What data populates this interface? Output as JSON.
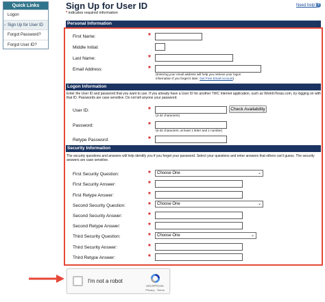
{
  "quick_links": {
    "title": "Quick Links",
    "items": [
      "Logon",
      "Sign Up for User ID",
      "Forgot Password?",
      "Forgot User ID?"
    ]
  },
  "page": {
    "title": "Sign Up for User ID",
    "help_link": "Need help?",
    "required_note": "indicates required information"
  },
  "personal": {
    "header": "Personal Information",
    "first_name": "First Name:",
    "middle_initial": "Middle Initial:",
    "last_name": "Last Name:",
    "email": "Email Address:",
    "email_hint_1": "(Entering your email address will help you retrieve your logon",
    "email_hint_2": "information if you forget it later.",
    "email_hint_link": "Get Free Email Account",
    "email_hint_end": ")"
  },
  "logon": {
    "header": "Logon Information",
    "intro": "Enter the User ID and password that you want to use. If you already have a User ID for another TWC Internet application, such as WorkInTexas.com, try logging on with that ID. Passwords are case sensitive. Do not tell anyone your password.",
    "user_id": "User ID:",
    "user_id_hint": "(3-32 characters)",
    "check_button": "Check Availability",
    "password": "Password:",
    "password_hint": "(6-32 characters, at least 1 letter and 1 number)",
    "retype_password": "Retype Password:"
  },
  "security": {
    "header": "Security Information",
    "intro": "The security questions and answers will help identify you if you forget your password. Select your questions and enter answers that others can't guess. The security answers are case sensitive.",
    "q1": "First Security Question:",
    "a1": "First Security Answer:",
    "r1": "First Retype Answer:",
    "q2": "Second Security Question:",
    "a2": "Second Security Answer:",
    "r2": "Second Retype Answer:",
    "q3": "Third Security Question:",
    "a3": "Third Security Answer:",
    "r3": "Third Retype Answer:",
    "select_default": "Choose One"
  },
  "captcha": {
    "label": "I'm not a robot",
    "brand": "reCAPTCHA",
    "links": "Privacy - Terms"
  },
  "colors": {
    "section_header": "#1b3461",
    "highlight_border": "#e64736",
    "required_star": "#d31616",
    "quick_links_header": "#30758b"
  }
}
